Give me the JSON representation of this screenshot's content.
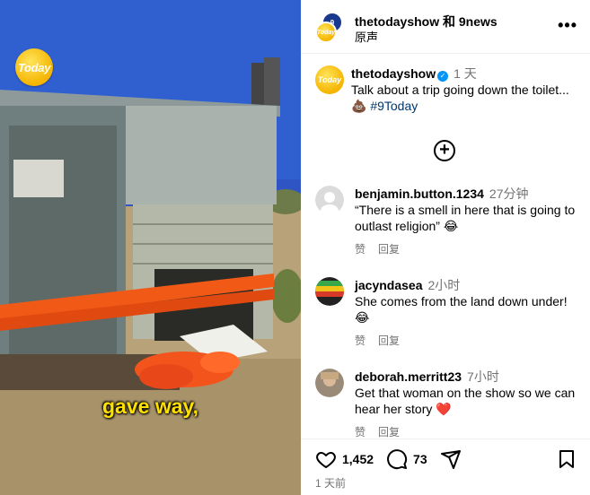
{
  "video": {
    "logo_text": "Today",
    "caption": "gave way,"
  },
  "header": {
    "avatar_9news": "9",
    "avatar_today": "Today",
    "accounts": "thetodayshow 和 9news",
    "audio": "原声",
    "more": "•••"
  },
  "post": {
    "username": "thetodayshow",
    "verified": "✓",
    "time": "1 天",
    "text": "Talk about a trip going down the toilet... 💩",
    "hashtag": "#9Today",
    "avatar_text": "Today"
  },
  "load_more": "+",
  "comments": [
    {
      "username": "benjamin.button.1234",
      "time": "27分钟",
      "text": "“There is a smell in here that is going to outlast religion” 😂",
      "like_label": "赞",
      "reply_label": "回复"
    },
    {
      "username": "jacyndasea",
      "time": "2小时",
      "text": "She comes from the land down under! 😂",
      "like_label": "赞",
      "reply_label": "回复"
    },
    {
      "username": "deborah.merritt23",
      "time": "7小时",
      "text": "Get that woman on the show so we can hear her story ❤️",
      "like_label": "赞",
      "reply_label": "回复"
    }
  ],
  "footer": {
    "likes": "1,452",
    "comments": "73",
    "time": "1 天前"
  },
  "icons": [
    "heart-icon",
    "comment-icon",
    "share-icon",
    "bookmark-icon",
    "more-icon",
    "add-circle-icon",
    "verified-icon"
  ]
}
